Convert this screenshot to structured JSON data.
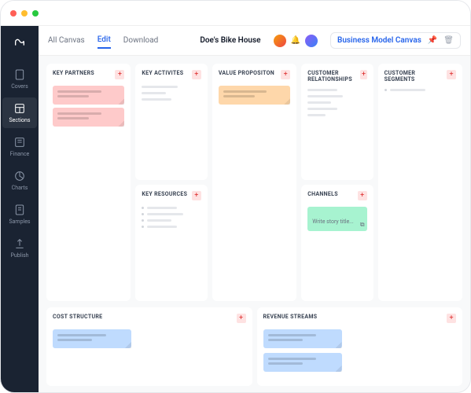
{
  "doc_title": "Doe's Bike House",
  "canvas_title": "Business Model Canvas",
  "tabs": {
    "all": "All Canvas",
    "edit": "Edit",
    "download": "Download"
  },
  "sidebar": {
    "covers": "Covers",
    "sections": "Sections",
    "finance": "Finance",
    "charts": "Charts",
    "samples": "Samples",
    "publish": "Publish"
  },
  "sections": {
    "key_partners": "KEY PARTNERS",
    "key_activities": "KEY ACTIVITES",
    "key_resources": "KEY RESOURCES",
    "value_proposition": "VALUE PROPOSITON",
    "customer_relationships": "CUSTOMER RELATIONSHIPS",
    "channels": "CHANNELS",
    "customer_segments": "CUSTOMER SEGMENTS",
    "cost_structure": "COST STRUCTURE",
    "revenue_streams": "REVENUE STREAMS"
  },
  "placeholder": "Write story title...",
  "add_symbol": "+"
}
